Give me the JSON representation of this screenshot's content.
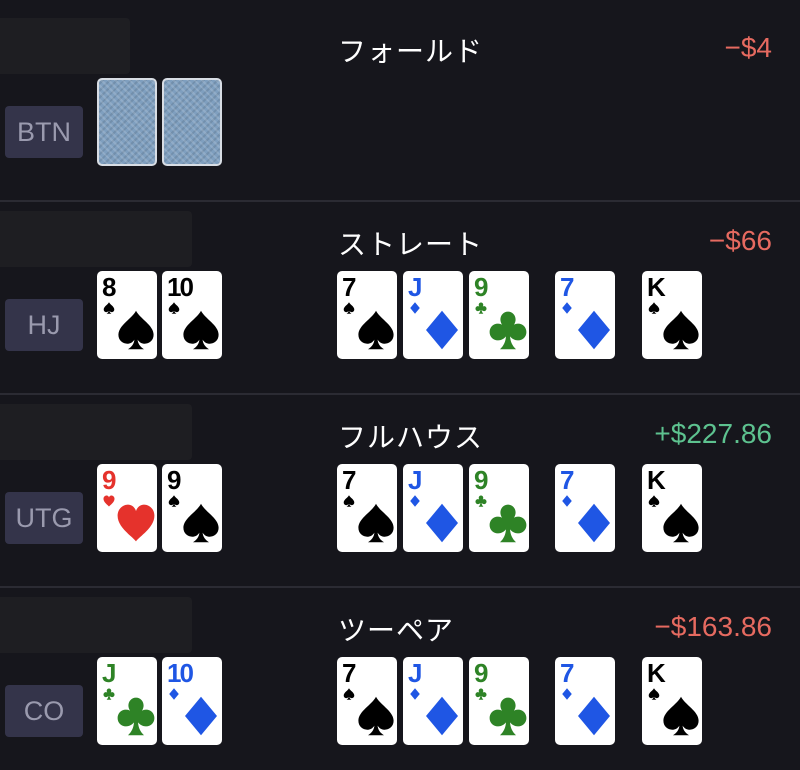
{
  "rows": [
    {
      "position": "BTN",
      "hand_label": "フォールド",
      "result": "−$4",
      "result_color": "#e66a60",
      "hole_cards": [
        {
          "rank": "",
          "suit": "back"
        },
        {
          "rank": "",
          "suit": "back"
        }
      ],
      "board": []
    },
    {
      "position": "HJ",
      "hand_label": "ストレート",
      "result": "−$66",
      "result_color": "#e66a60",
      "hole_cards": [
        {
          "rank": "8",
          "suit": "spade"
        },
        {
          "rank": "10",
          "suit": "spade"
        }
      ],
      "board": [
        {
          "rank": "7",
          "suit": "spade"
        },
        {
          "rank": "J",
          "suit": "diamond"
        },
        {
          "rank": "9",
          "suit": "club"
        },
        {
          "rank": "7",
          "suit": "diamond"
        },
        {
          "rank": "K",
          "suit": "spade"
        }
      ]
    },
    {
      "position": "UTG",
      "hand_label": "フルハウス",
      "result": "+$227.86",
      "result_color": "#5dc28f",
      "hole_cards": [
        {
          "rank": "9",
          "suit": "heart"
        },
        {
          "rank": "9",
          "suit": "spade"
        }
      ],
      "board": [
        {
          "rank": "7",
          "suit": "spade"
        },
        {
          "rank": "J",
          "suit": "diamond"
        },
        {
          "rank": "9",
          "suit": "club"
        },
        {
          "rank": "7",
          "suit": "diamond"
        },
        {
          "rank": "K",
          "suit": "spade"
        }
      ]
    },
    {
      "position": "CO",
      "hand_label": "ツーペア",
      "result": "−$163.86",
      "result_color": "#e66a60",
      "hole_cards": [
        {
          "rank": "J",
          "suit": "club"
        },
        {
          "rank": "10",
          "suit": "diamond"
        }
      ],
      "board": [
        {
          "rank": "7",
          "suit": "spade"
        },
        {
          "rank": "J",
          "suit": "diamond"
        },
        {
          "rank": "9",
          "suit": "club"
        },
        {
          "rank": "7",
          "suit": "diamond"
        },
        {
          "rank": "K",
          "suit": "spade"
        }
      ]
    }
  ]
}
